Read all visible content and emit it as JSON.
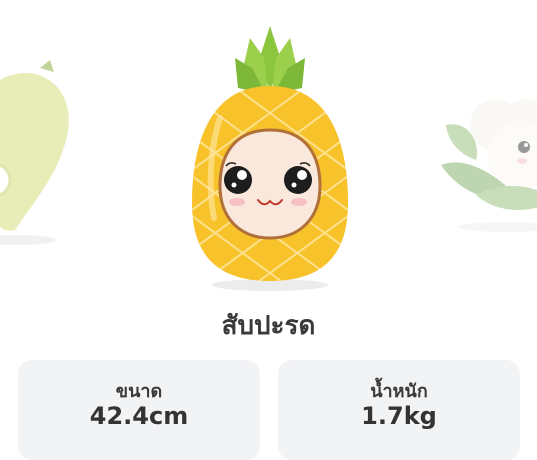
{
  "carousel": {
    "items": [
      {
        "name": "mango-character"
      },
      {
        "name": "pineapple-character"
      },
      {
        "name": "cauliflower-character"
      }
    ]
  },
  "fruit": {
    "name": "สับปะรด"
  },
  "stats": {
    "size": {
      "label": "ขนาด",
      "value": "42.4cm"
    },
    "weight": {
      "label": "น้ำหนัก",
      "value": "1.7kg"
    }
  },
  "colors": {
    "pineapple_body": "#f7c22a",
    "pineapple_leaves": "#8cc63f",
    "face": "#fbe8dc",
    "card_bg": "#f2f3f5",
    "text": "#3a3a3a"
  }
}
